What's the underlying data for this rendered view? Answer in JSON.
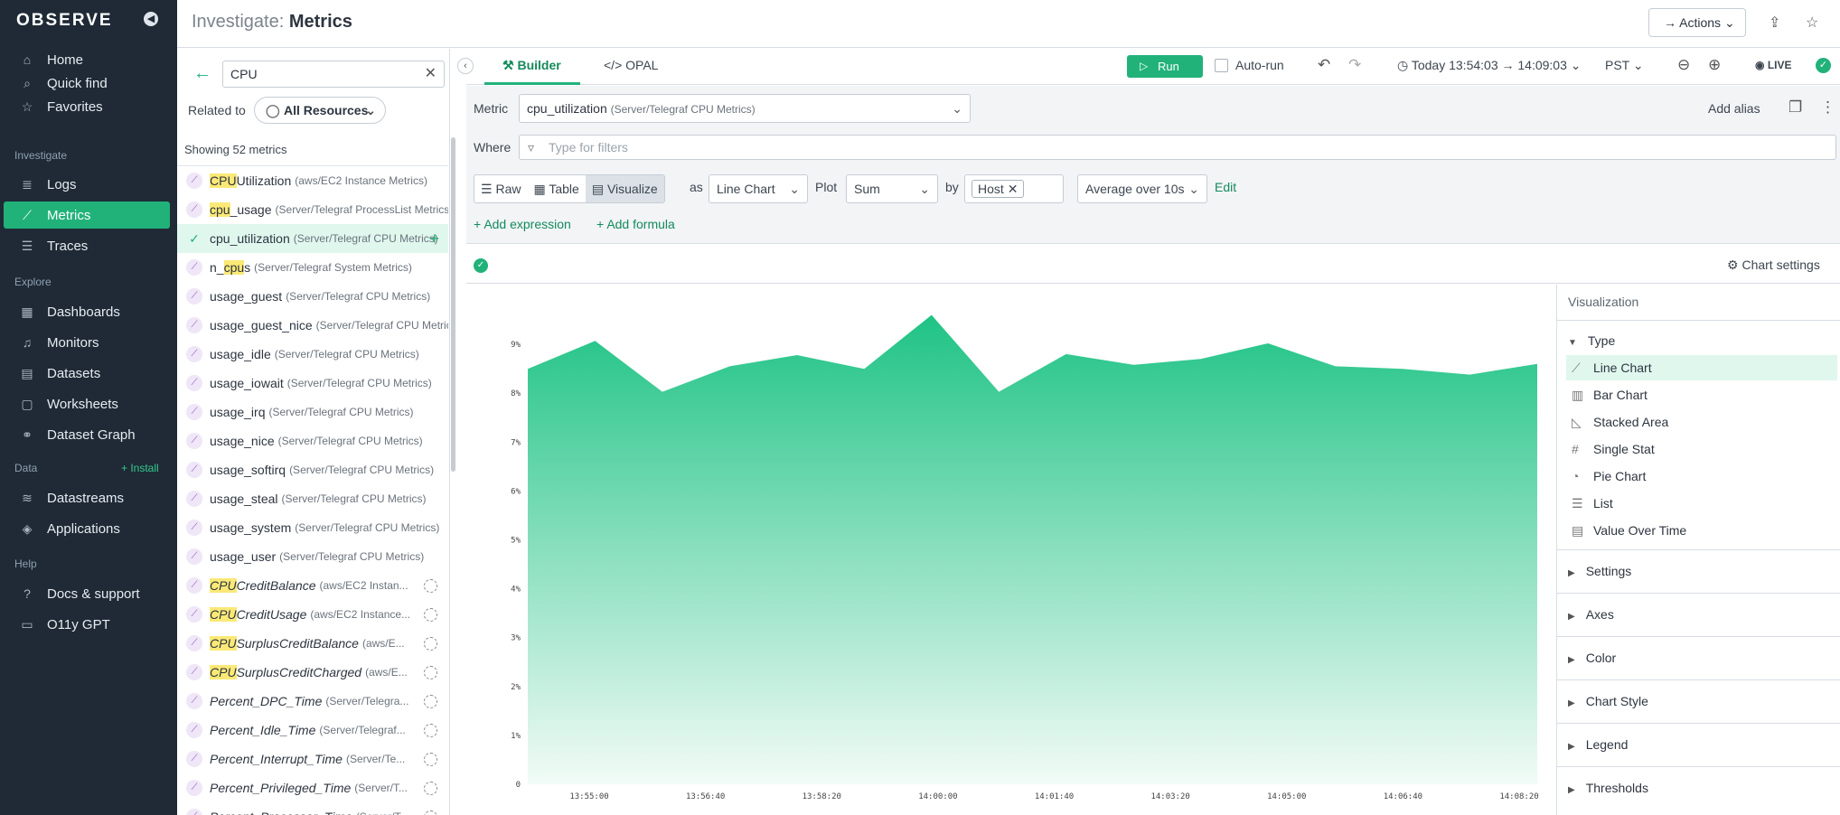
{
  "nav": {
    "logo": "OBSERVE",
    "items_top": [
      {
        "label": "Home",
        "icon": "home-icon",
        "glyph": "⌂"
      },
      {
        "label": "Quick find",
        "icon": "search-icon",
        "glyph": "⌕"
      },
      {
        "label": "Favorites",
        "icon": "star-icon",
        "glyph": "☆"
      }
    ],
    "sections": {
      "investigate": "Investigate",
      "explore": "Explore",
      "data": "Data",
      "help": "Help",
      "install": "+ Install"
    },
    "investigate_items": [
      {
        "label": "Logs",
        "icon": "logs-icon",
        "glyph": "≣"
      },
      {
        "label": "Metrics",
        "icon": "metrics-icon",
        "glyph": "⟋"
      },
      {
        "label": "Traces",
        "icon": "traces-icon",
        "glyph": "☰"
      }
    ],
    "explore_items": [
      {
        "label": "Dashboards",
        "icon": "dashboards-icon",
        "glyph": "▦"
      },
      {
        "label": "Monitors",
        "icon": "bell-icon",
        "glyph": "♫"
      },
      {
        "label": "Datasets",
        "icon": "datasets-icon",
        "glyph": "▤"
      },
      {
        "label": "Worksheets",
        "icon": "worksheets-icon",
        "glyph": "▢"
      },
      {
        "label": "Dataset Graph",
        "icon": "graph-icon",
        "glyph": "⚭"
      }
    ],
    "data_items": [
      {
        "label": "Datastreams",
        "icon": "datastreams-icon",
        "glyph": "≋"
      },
      {
        "label": "Applications",
        "icon": "applications-icon",
        "glyph": "◈"
      }
    ],
    "help_items": [
      {
        "label": "Docs & support",
        "icon": "help-icon",
        "glyph": "?"
      },
      {
        "label": "O11y GPT",
        "icon": "chat-icon",
        "glyph": "▭"
      }
    ]
  },
  "panel": {
    "search_value": "CPU",
    "related_label": "Related to",
    "resource_button": "All Resources",
    "showing": "Showing 52 metrics",
    "metrics": [
      {
        "pre": "",
        "hl": "CPU",
        "post": "Utilization",
        "src": "(aws/EC2 Instance Metrics)",
        "italic": false
      },
      {
        "pre": "",
        "hl": "cpu",
        "post": "_usage",
        "src": "(Server/Telegraf ProcessList Metrics)",
        "italic": false
      },
      {
        "pre": "",
        "hl": "",
        "post": "cpu_utilization",
        "src": "(Server/Telegraf CPU Metrics)",
        "italic": false,
        "selected": true
      },
      {
        "pre": "n_",
        "hl": "cpu",
        "post": "s",
        "src": "(Server/Telegraf System Metrics)",
        "italic": false
      },
      {
        "pre": "usage_guest",
        "hl": "",
        "post": "",
        "src": "(Server/Telegraf CPU Metrics)",
        "italic": false
      },
      {
        "pre": "usage_guest_nice",
        "hl": "",
        "post": "",
        "src": "(Server/Telegraf CPU Metrics)",
        "italic": false
      },
      {
        "pre": "usage_idle",
        "hl": "",
        "post": "",
        "src": "(Server/Telegraf CPU Metrics)",
        "italic": false
      },
      {
        "pre": "usage_iowait",
        "hl": "",
        "post": "",
        "src": "(Server/Telegraf CPU Metrics)",
        "italic": false
      },
      {
        "pre": "usage_irq",
        "hl": "",
        "post": "",
        "src": "(Server/Telegraf CPU Metrics)",
        "italic": false
      },
      {
        "pre": "usage_nice",
        "hl": "",
        "post": "",
        "src": "(Server/Telegraf CPU Metrics)",
        "italic": false
      },
      {
        "pre": "usage_softirq",
        "hl": "",
        "post": "",
        "src": "(Server/Telegraf CPU Metrics)",
        "italic": false
      },
      {
        "pre": "usage_steal",
        "hl": "",
        "post": "",
        "src": "(Server/Telegraf CPU Metrics)",
        "italic": false
      },
      {
        "pre": "usage_system",
        "hl": "",
        "post": "",
        "src": "(Server/Telegraf CPU Metrics)",
        "italic": false
      },
      {
        "pre": "usage_user",
        "hl": "",
        "post": "",
        "src": "(Server/Telegraf CPU Metrics)",
        "italic": false
      },
      {
        "pre": "",
        "hl": "CPU",
        "post": "CreditBalance",
        "src": "(aws/EC2 Instan...",
        "italic": true
      },
      {
        "pre": "",
        "hl": "CPU",
        "post": "CreditUsage",
        "src": "(aws/EC2 Instance...",
        "italic": true
      },
      {
        "pre": "",
        "hl": "CPU",
        "post": "SurplusCreditBalance",
        "src": "(aws/E...",
        "italic": true
      },
      {
        "pre": "",
        "hl": "CPU",
        "post": "SurplusCreditCharged",
        "src": "(aws/E...",
        "italic": true
      },
      {
        "pre": "Percent_DPC_Time",
        "hl": "",
        "post": "",
        "src": "(Server/Telegra...",
        "italic": true
      },
      {
        "pre": "Percent_Idle_Time",
        "hl": "",
        "post": "",
        "src": "(Server/Telegraf...",
        "italic": true
      },
      {
        "pre": "Percent_Interrupt_Time",
        "hl": "",
        "post": "",
        "src": "(Server/Te...",
        "italic": true
      },
      {
        "pre": "Percent_Privileged_Time",
        "hl": "",
        "post": "",
        "src": "(Server/T...",
        "italic": true
      },
      {
        "pre": "Percent_Processor_Time",
        "hl": "",
        "post": "",
        "src": "(Server/T...",
        "italic": true
      }
    ]
  },
  "header": {
    "title_prefix": "Investigate:",
    "title_main": "Metrics",
    "actions": "Actions"
  },
  "toolbar": {
    "tab_builder": "Builder",
    "tab_opal": "OPAL",
    "run": "Run",
    "autorun": "Auto-run",
    "time_range": "Today 13:54:03 → 14:09:03",
    "timezone": "PST",
    "live": "LIVE"
  },
  "builder": {
    "metric_label": "Metric",
    "metric_value": "cpu_utilization",
    "metric_source": "(Server/Telegraf CPU Metrics)",
    "add_alias": "Add alias",
    "where_label": "Where",
    "where_placeholder": "Type for filters",
    "mode_raw": "Raw",
    "mode_table": "Table",
    "mode_visualize": "Visualize",
    "as_label": "as",
    "chart_type": "Line Chart",
    "plot_label": "Plot",
    "plot_value": "Sum",
    "by_label": "by",
    "group_chip": "Host",
    "rollup": "Average over 10s",
    "edit": "Edit",
    "add_expression": "Add expression",
    "add_formula": "Add formula"
  },
  "chart_settings": "Chart settings",
  "viz": {
    "title": "Visualization",
    "type_head": "Type",
    "types": [
      {
        "label": "Line Chart",
        "icon": "line-chart-icon",
        "glyph": "⟋"
      },
      {
        "label": "Bar Chart",
        "icon": "bar-chart-icon",
        "glyph": "▥"
      },
      {
        "label": "Stacked Area",
        "icon": "stacked-area-icon",
        "glyph": "◺"
      },
      {
        "label": "Single Stat",
        "icon": "hash-icon",
        "glyph": "#"
      },
      {
        "label": "Pie Chart",
        "icon": "pie-chart-icon",
        "glyph": "◔"
      },
      {
        "label": "List",
        "icon": "list-icon",
        "glyph": "☰"
      },
      {
        "label": "Value Over Time",
        "icon": "value-over-time-icon",
        "glyph": "▤"
      }
    ],
    "sections": [
      "Settings",
      "Axes",
      "Color",
      "Chart Style",
      "Legend",
      "Thresholds"
    ]
  },
  "colors": {
    "accent": "#21b27a",
    "nav_bg": "#1f2a36",
    "area_top": "#1fc385",
    "area_bottom": "#f2fbf7"
  },
  "chart_data": {
    "type": "area",
    "x": [
      "13:54:03",
      "13:55:00",
      "13:56:40",
      "13:57:30",
      "13:58:20",
      "13:59:10",
      "14:00:00",
      "14:00:50",
      "14:01:40",
      "14:02:30",
      "14:03:20",
      "14:04:10",
      "14:05:00",
      "14:05:50",
      "14:06:40",
      "14:07:30",
      "14:08:20",
      "14:09:03"
    ],
    "series": [
      {
        "values": [
          8.5,
          9.07,
          8.03,
          8.55,
          8.78,
          8.5,
          9.6,
          8.03,
          8.8,
          8.58,
          8.7,
          9.02,
          8.55,
          8.5,
          8.38,
          8.6
        ]
      }
    ],
    "x_ticks": [
      "13:55:00",
      "13:56:40",
      "13:58:20",
      "14:00:00",
      "14:01:40",
      "14:03:20",
      "14:05:00",
      "14:06:40",
      "14:08:20"
    ],
    "y_ticks": [
      "0",
      "1%",
      "2%",
      "3%",
      "4%",
      "5%",
      "6%",
      "7%",
      "8%",
      "9%"
    ],
    "ylim": [
      0,
      10
    ],
    "grid": false,
    "legend": "none"
  }
}
